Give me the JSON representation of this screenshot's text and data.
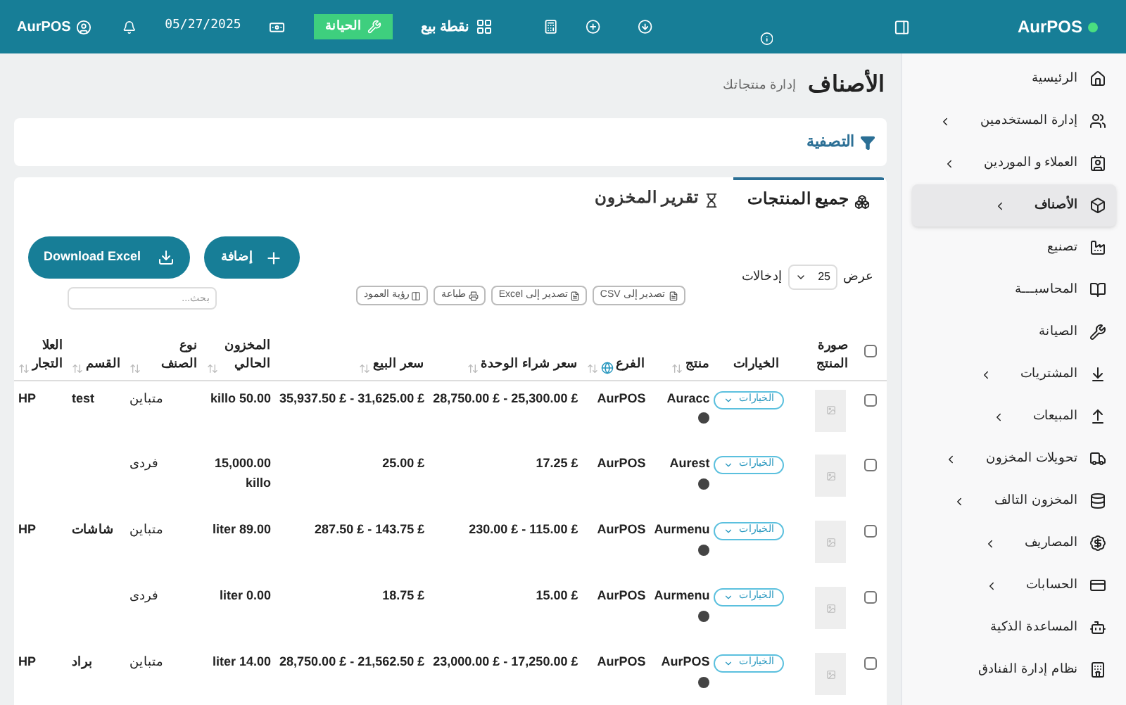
{
  "topbar": {
    "brand": "AurPOS",
    "pos_label": "نقطة بيع",
    "maintenance_label": "الحيانة",
    "date": "05/27/2025",
    "user": "AurPOS"
  },
  "sidebar": {
    "items": [
      {
        "label": "الرئيسية",
        "has_children": false,
        "selected": false
      },
      {
        "label": "إدارة المستخدمين",
        "has_children": true,
        "selected": false
      },
      {
        "label": "العملاء و الموردين",
        "has_children": true,
        "selected": false
      },
      {
        "label": "الأصناف",
        "has_children": true,
        "selected": true
      },
      {
        "label": "تصنيع",
        "has_children": false,
        "selected": false
      },
      {
        "label": "المحاسبـــة",
        "has_children": false,
        "selected": false
      },
      {
        "label": "الصيانة",
        "has_children": false,
        "selected": false
      },
      {
        "label": "المشتريات",
        "has_children": true,
        "selected": false
      },
      {
        "label": "المبيعات",
        "has_children": true,
        "selected": false
      },
      {
        "label": "تحويلات المخزون",
        "has_children": true,
        "selected": false
      },
      {
        "label": "المخزون التالف",
        "has_children": true,
        "selected": false
      },
      {
        "label": "المصاريف",
        "has_children": true,
        "selected": false
      },
      {
        "label": "الحسابات",
        "has_children": true,
        "selected": false
      },
      {
        "label": "المساعدة الذكية",
        "has_children": false,
        "selected": false
      },
      {
        "label": "نظام إدارة الفنادق",
        "has_children": false,
        "selected": false
      }
    ]
  },
  "page": {
    "title": "الأصناف",
    "subtitle": "إدارة منتجاتك"
  },
  "filter": {
    "label": "التصفية"
  },
  "tabs": [
    {
      "label": "جميع المنتجات",
      "selected": true
    },
    {
      "label": "تقرير المخزون",
      "selected": false
    }
  ],
  "toolbar": {
    "show_label": "عرض",
    "page_size": "25",
    "entries_label": "إدخالات",
    "exports": [
      "تصدير إلى CSV",
      "تصدير إلى Excel",
      "طباعة",
      "رؤية العمود"
    ],
    "add_button": "إضافة",
    "download_button": "Download Excel",
    "search_placeholder": "بحث..."
  },
  "table": {
    "select_all_checked": false,
    "columns": [
      "صورة المنتج",
      "الخيارات",
      "منتج",
      "الفرع",
      "سعر شراء الوحدة",
      "سعر البيع",
      "المخزون الحالي",
      "نوع الصنف",
      "القسم",
      "العلا التجار"
    ],
    "rows": [
      {
        "options": "الخيارات",
        "product": "Auracc",
        "branch": "AurPOS",
        "purchase": "28,750.00 £ - 25,300.00 £",
        "sale": "35,937.50 £ - 31,625.00 £",
        "stock": "killo 50.00",
        "type": "متباين",
        "category": "test",
        "brand": "HP",
        "checked": false
      },
      {
        "options": "الخيارات",
        "product": "Aurest",
        "branch": "AurPOS",
        "purchase": "17.25 £",
        "sale": "25.00 £",
        "stock": "15,000.00 killo",
        "type": "فردى",
        "checked": false
      },
      {
        "options": "الخيارات",
        "product": "Aurmenu",
        "branch": "AurPOS",
        "purchase": "230.00 £ - 115.00 £",
        "sale": "287.50 £ - 143.75 £",
        "stock": "liter 89.00",
        "type": "متباين",
        "category": "شاشات",
        "brand": "HP",
        "checked": false
      },
      {
        "options": "الخيارات",
        "product": "Aurmenu",
        "branch": "AurPOS",
        "purchase": "15.00 £",
        "sale": "18.75 £",
        "stock": "liter 0.00",
        "type": "فردى",
        "checked": false
      },
      {
        "options": "الخيارات",
        "product": "AurPOS",
        "branch": "AurPOS",
        "purchase": "23,000.00 £ - 17,250.00 £",
        "sale": "28,750.00 £ - 21,562.50 £",
        "stock": "liter 14.00",
        "type": "متباين",
        "category": "براد",
        "brand": "HP",
        "checked": false
      }
    ]
  }
}
